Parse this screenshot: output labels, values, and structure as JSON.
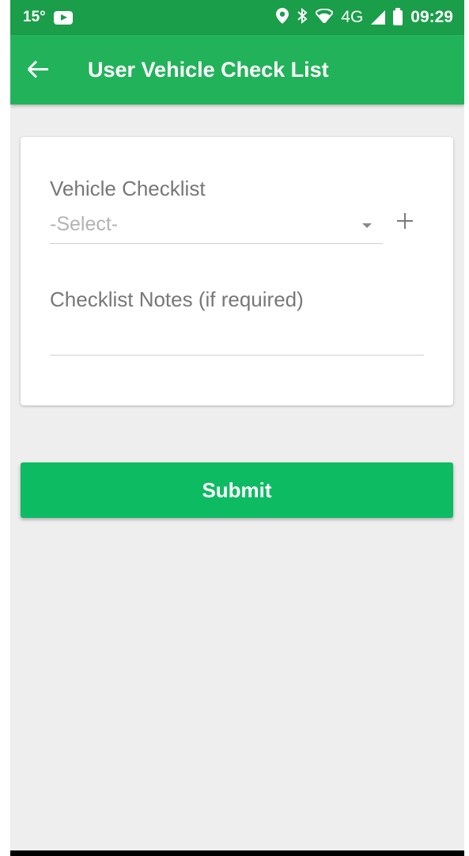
{
  "status_bar": {
    "temperature": "15°",
    "network": "4G",
    "time": "09:29",
    "icons": [
      "youtube-icon",
      "location-icon",
      "bluetooth-icon",
      "wifi-icon",
      "signal-icon",
      "battery-icon"
    ]
  },
  "app_bar": {
    "title": "User Vehicle Check List",
    "back_icon": "arrow-left-icon",
    "color": "#22b35a"
  },
  "form": {
    "checklist_label": "Vehicle Checklist",
    "checklist_value": "-Select-",
    "notes_label": "Checklist Notes (if required)",
    "notes_value": ""
  },
  "submit": {
    "label": "Submit",
    "color": "#0dbb62"
  }
}
